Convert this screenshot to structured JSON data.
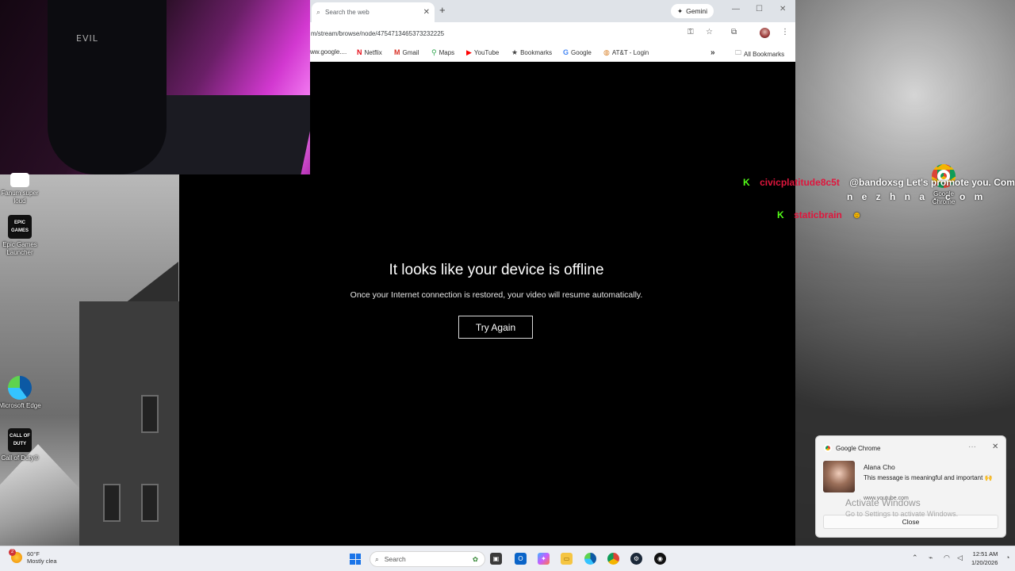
{
  "webcam": {
    "shirt_text": "EVIL"
  },
  "browser": {
    "tab_title": "Search the web",
    "new_tab": "+",
    "gemini_label": "Gemini",
    "url": "m/stream/browse/node/4754713465373232225",
    "bookmarks": [
      {
        "label": "ww.google....",
        "icon": ""
      },
      {
        "label": "Netflix",
        "icon": "netflix-icon"
      },
      {
        "label": "Gmail",
        "icon": "gmail-icon"
      },
      {
        "label": "Maps",
        "icon": "maps-icon"
      },
      {
        "label": "YouTube",
        "icon": "youtube-icon"
      },
      {
        "label": "Bookmarks",
        "icon": "star-icon"
      },
      {
        "label": "Google",
        "icon": "google-icon"
      },
      {
        "label": "AT&T - Login",
        "icon": "att-icon"
      }
    ],
    "all_bookmarks": "All Bookmarks"
  },
  "video": {
    "title": "It looks like your device is offline",
    "subtitle": "Once your Internet connection is restored, your video will resume automatically.",
    "button": "Try Again"
  },
  "desktop_icons": [
    {
      "label": "Fanum super loud"
    },
    {
      "label": "Epic Games Launcher",
      "glyph": "EPIC GAMES"
    },
    {
      "label": "Microsoft Edge"
    },
    {
      "label": "Call of Duty®",
      "glyph": "CALL OF DUTY"
    },
    {
      "label": "Google Chrome"
    }
  ],
  "chat": [
    {
      "user": "civicplatitude8c5t",
      "msg": "@bandoxsg Let's promote you. Come",
      "cont": "n e z h n a . c o m"
    },
    {
      "user": "staticbrain",
      "msg": ""
    }
  ],
  "notification": {
    "app": "Google Chrome",
    "sender": "Alana Cho",
    "body": "This message is meaningful and important 🙌",
    "site": "www.youtube.com",
    "close": "Close",
    "activate_title": "Activate Windows",
    "activate_sub": "Go to Settings to activate Windows."
  },
  "taskbar": {
    "temp": "60°F",
    "weather": "Mostly clea",
    "weather_badge": "2",
    "search": "Search",
    "time": "12:51 AM",
    "date": "1/20/2026"
  },
  "colors": {
    "chat_user": "#e0163d",
    "kick_green": "#53fc18",
    "windows_blue": "#1a74e8"
  }
}
